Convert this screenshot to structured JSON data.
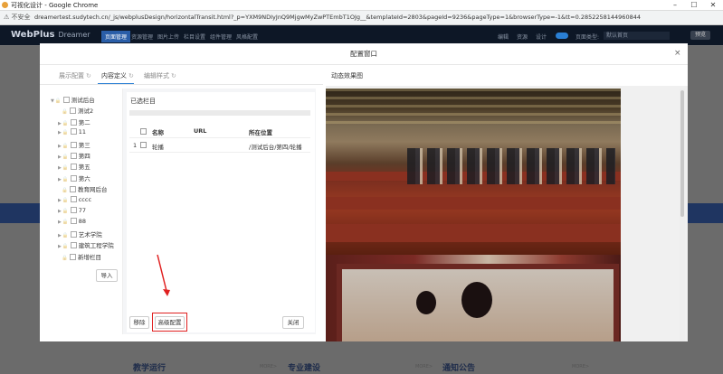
{
  "browser": {
    "window_title": "可视化设计 - Google Chrome",
    "security_label": "不安全",
    "url": "dreamertest.sudytech.cn/_js/webplusDesign/horizontalTransit.html?_p=YXM9NDIyJnQ9MjgwMyZwPTEmbT1OJg__&templateId=2803&pageId=9236&pageType=1&browserType=-1&tt=0.2852258144960844",
    "minimize": "–",
    "maximize": "☐",
    "close": "✕"
  },
  "app": {
    "brand": "WebPlus",
    "brand_sub": "Dreamer",
    "nav": [
      "页面管理",
      "资源管理",
      "图片上传",
      "栏目设置",
      "组件管理",
      "风格配置"
    ],
    "right_links": [
      "编辑",
      "资源",
      "设计"
    ],
    "page_type_label": "页面类型:",
    "page_type_value": "默认首页",
    "preview_label": "预览"
  },
  "background": {
    "sections": [
      "教学运行",
      "专业建设",
      "通知公告"
    ],
    "more": "MORE>"
  },
  "modal": {
    "title": "配置窗口",
    "close": "×",
    "tabs": [
      {
        "label": "展示配置",
        "active": false
      },
      {
        "label": "内容定义",
        "active": true
      },
      {
        "label": "编辑样式",
        "active": false
      }
    ],
    "tab_icon": "↻",
    "effect_title": "动态效果图",
    "tree": [
      {
        "label": "测试后台",
        "level": 0,
        "expanded": true
      },
      {
        "label": "测试2",
        "level": 1
      },
      {
        "label": "第二",
        "level": 1,
        "expandable": true
      },
      {
        "label": "11",
        "level": 1,
        "expandable": true
      },
      {
        "label": "第三",
        "level": 1,
        "expandable": true
      },
      {
        "label": "第四",
        "level": 1,
        "expandable": true
      },
      {
        "label": "第五",
        "level": 1,
        "expandable": true
      },
      {
        "label": "第六",
        "level": 1,
        "expandable": true
      },
      {
        "label": "教育网后台",
        "level": 1
      },
      {
        "label": "cccc",
        "level": 1,
        "expandable": true
      },
      {
        "label": "77",
        "level": 1,
        "expandable": true
      },
      {
        "label": "88",
        "level": 1,
        "expandable": true
      },
      {
        "label": "艺术学院",
        "level": 1,
        "expandable": true
      },
      {
        "label": "建筑工程学院",
        "level": 1,
        "expandable": true
      },
      {
        "label": "新增栏目",
        "level": 1
      }
    ],
    "import_button": "导入",
    "selected_title": "已选栏目",
    "table": {
      "headers": [
        "名称",
        "URL",
        "所在位置"
      ],
      "rows": [
        {
          "index": "1",
          "name": "轮播",
          "url": "",
          "location": "/测试后台/第四/轮播"
        }
      ]
    },
    "remove_button": "移除",
    "advanced_button": "高级配置",
    "close_button": "关闭"
  }
}
